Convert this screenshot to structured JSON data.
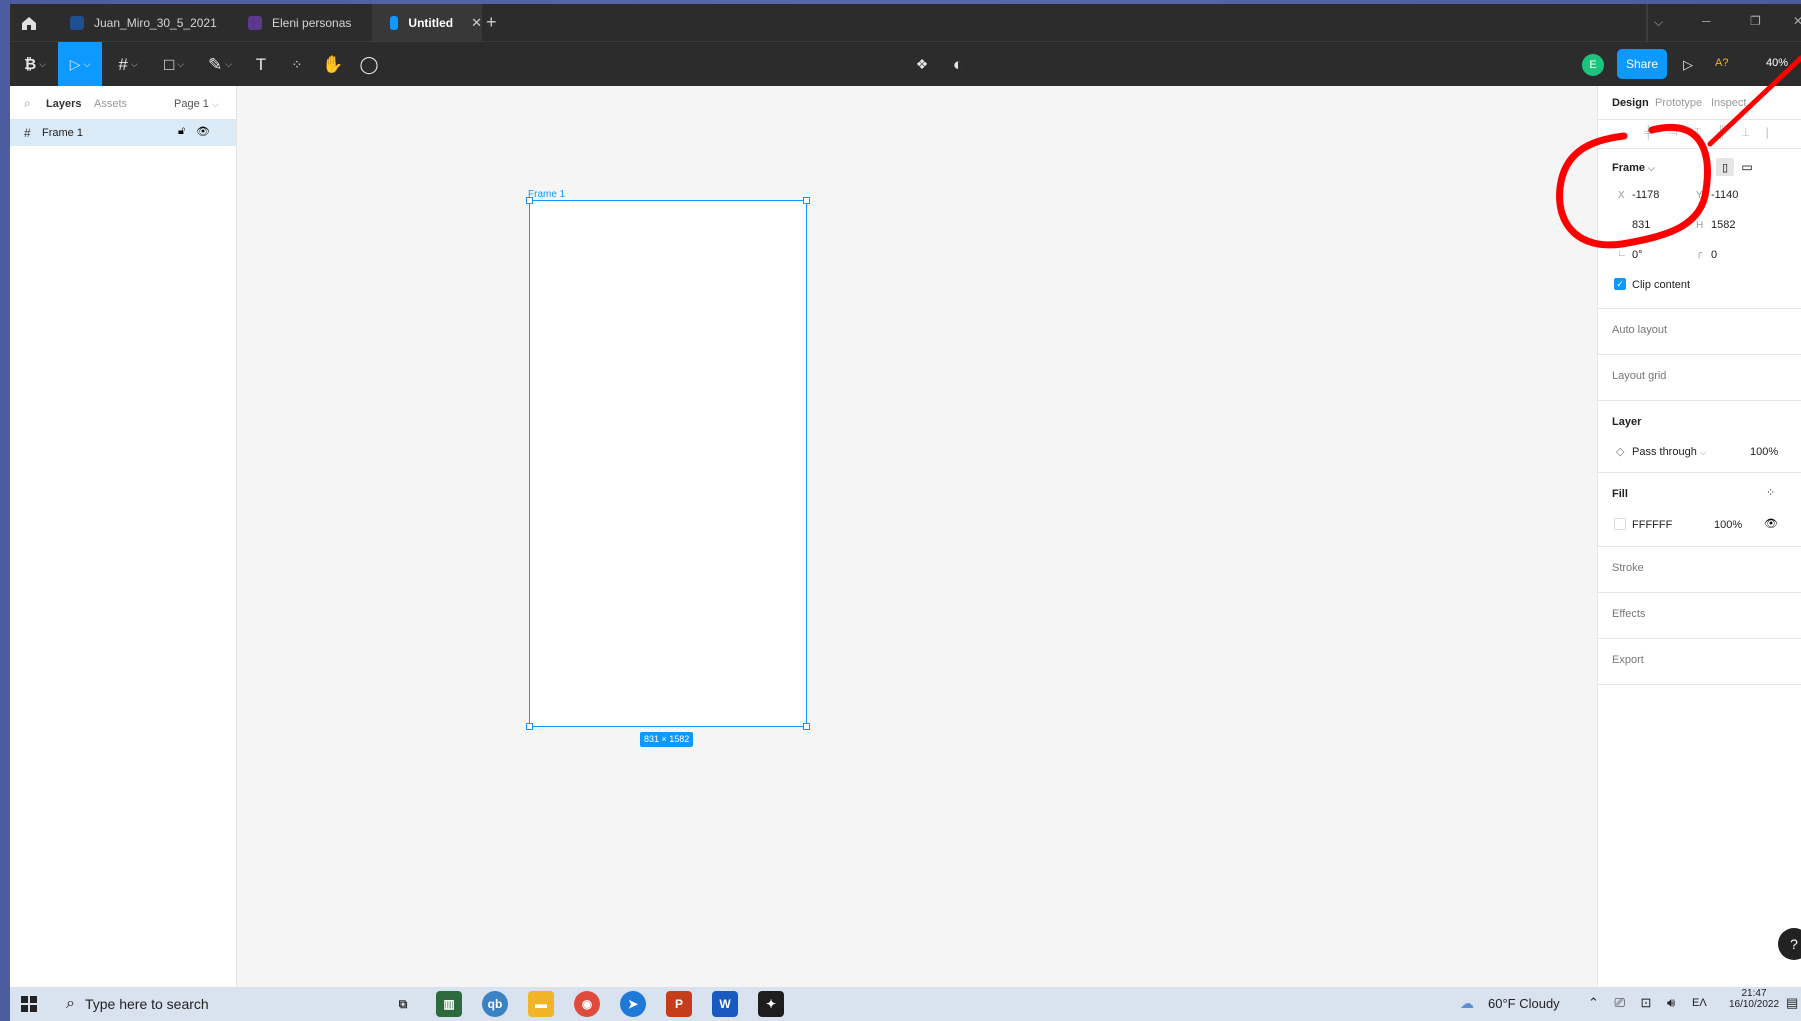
{
  "tabs": [
    {
      "label": "Juan_Miro_30_5_2021",
      "active": false
    },
    {
      "label": "Eleni personas",
      "active": false
    },
    {
      "label": "Untitled",
      "active": true
    }
  ],
  "window_controls": {
    "dropdown": "⌵",
    "minimize": "─",
    "restore": "❐",
    "close": "✕"
  },
  "toolbar": {
    "share_label": "Share",
    "avatar_initial": "E",
    "font_warning": "A?",
    "zoom": "40%"
  },
  "left_panel": {
    "tab_layers": "Layers",
    "tab_assets": "Assets",
    "page_selector": "Page 1",
    "layers": [
      {
        "name": "Frame 1"
      }
    ]
  },
  "canvas": {
    "frame_name": "Frame 1",
    "frame_size_badge": "831 × 1582"
  },
  "right_panel": {
    "tabs": [
      "Design",
      "Prototype",
      "Inspect"
    ],
    "frame_section": "Frame",
    "x_label": "X",
    "x_value": "-1178",
    "y_label": "Y",
    "y_value": "-1140",
    "w_value": "831",
    "h_label": "H",
    "h_value": "1582",
    "rotation": "0°",
    "radius": "0",
    "clip_content": "Clip content",
    "auto_layout": "Auto layout",
    "layout_grid": "Layout grid",
    "layer_section": "Layer",
    "blend_mode": "Pass through",
    "layer_opacity": "100%",
    "fill_section": "Fill",
    "fill_hex": "FFFFFF",
    "fill_opacity": "100%",
    "stroke": "Stroke",
    "effects": "Effects",
    "export": "Export",
    "help": "?"
  },
  "taskbar": {
    "search_placeholder": "Type here to search",
    "weather": "60°F  Cloudy",
    "lang": "ΕΛ",
    "time": "21:47",
    "date": "16/10/2022"
  },
  "colors": {
    "accent": "#0d99ff",
    "annotation": "#ff0000",
    "share_button": "#0d99ff",
    "avatar": "#1bc47d"
  }
}
